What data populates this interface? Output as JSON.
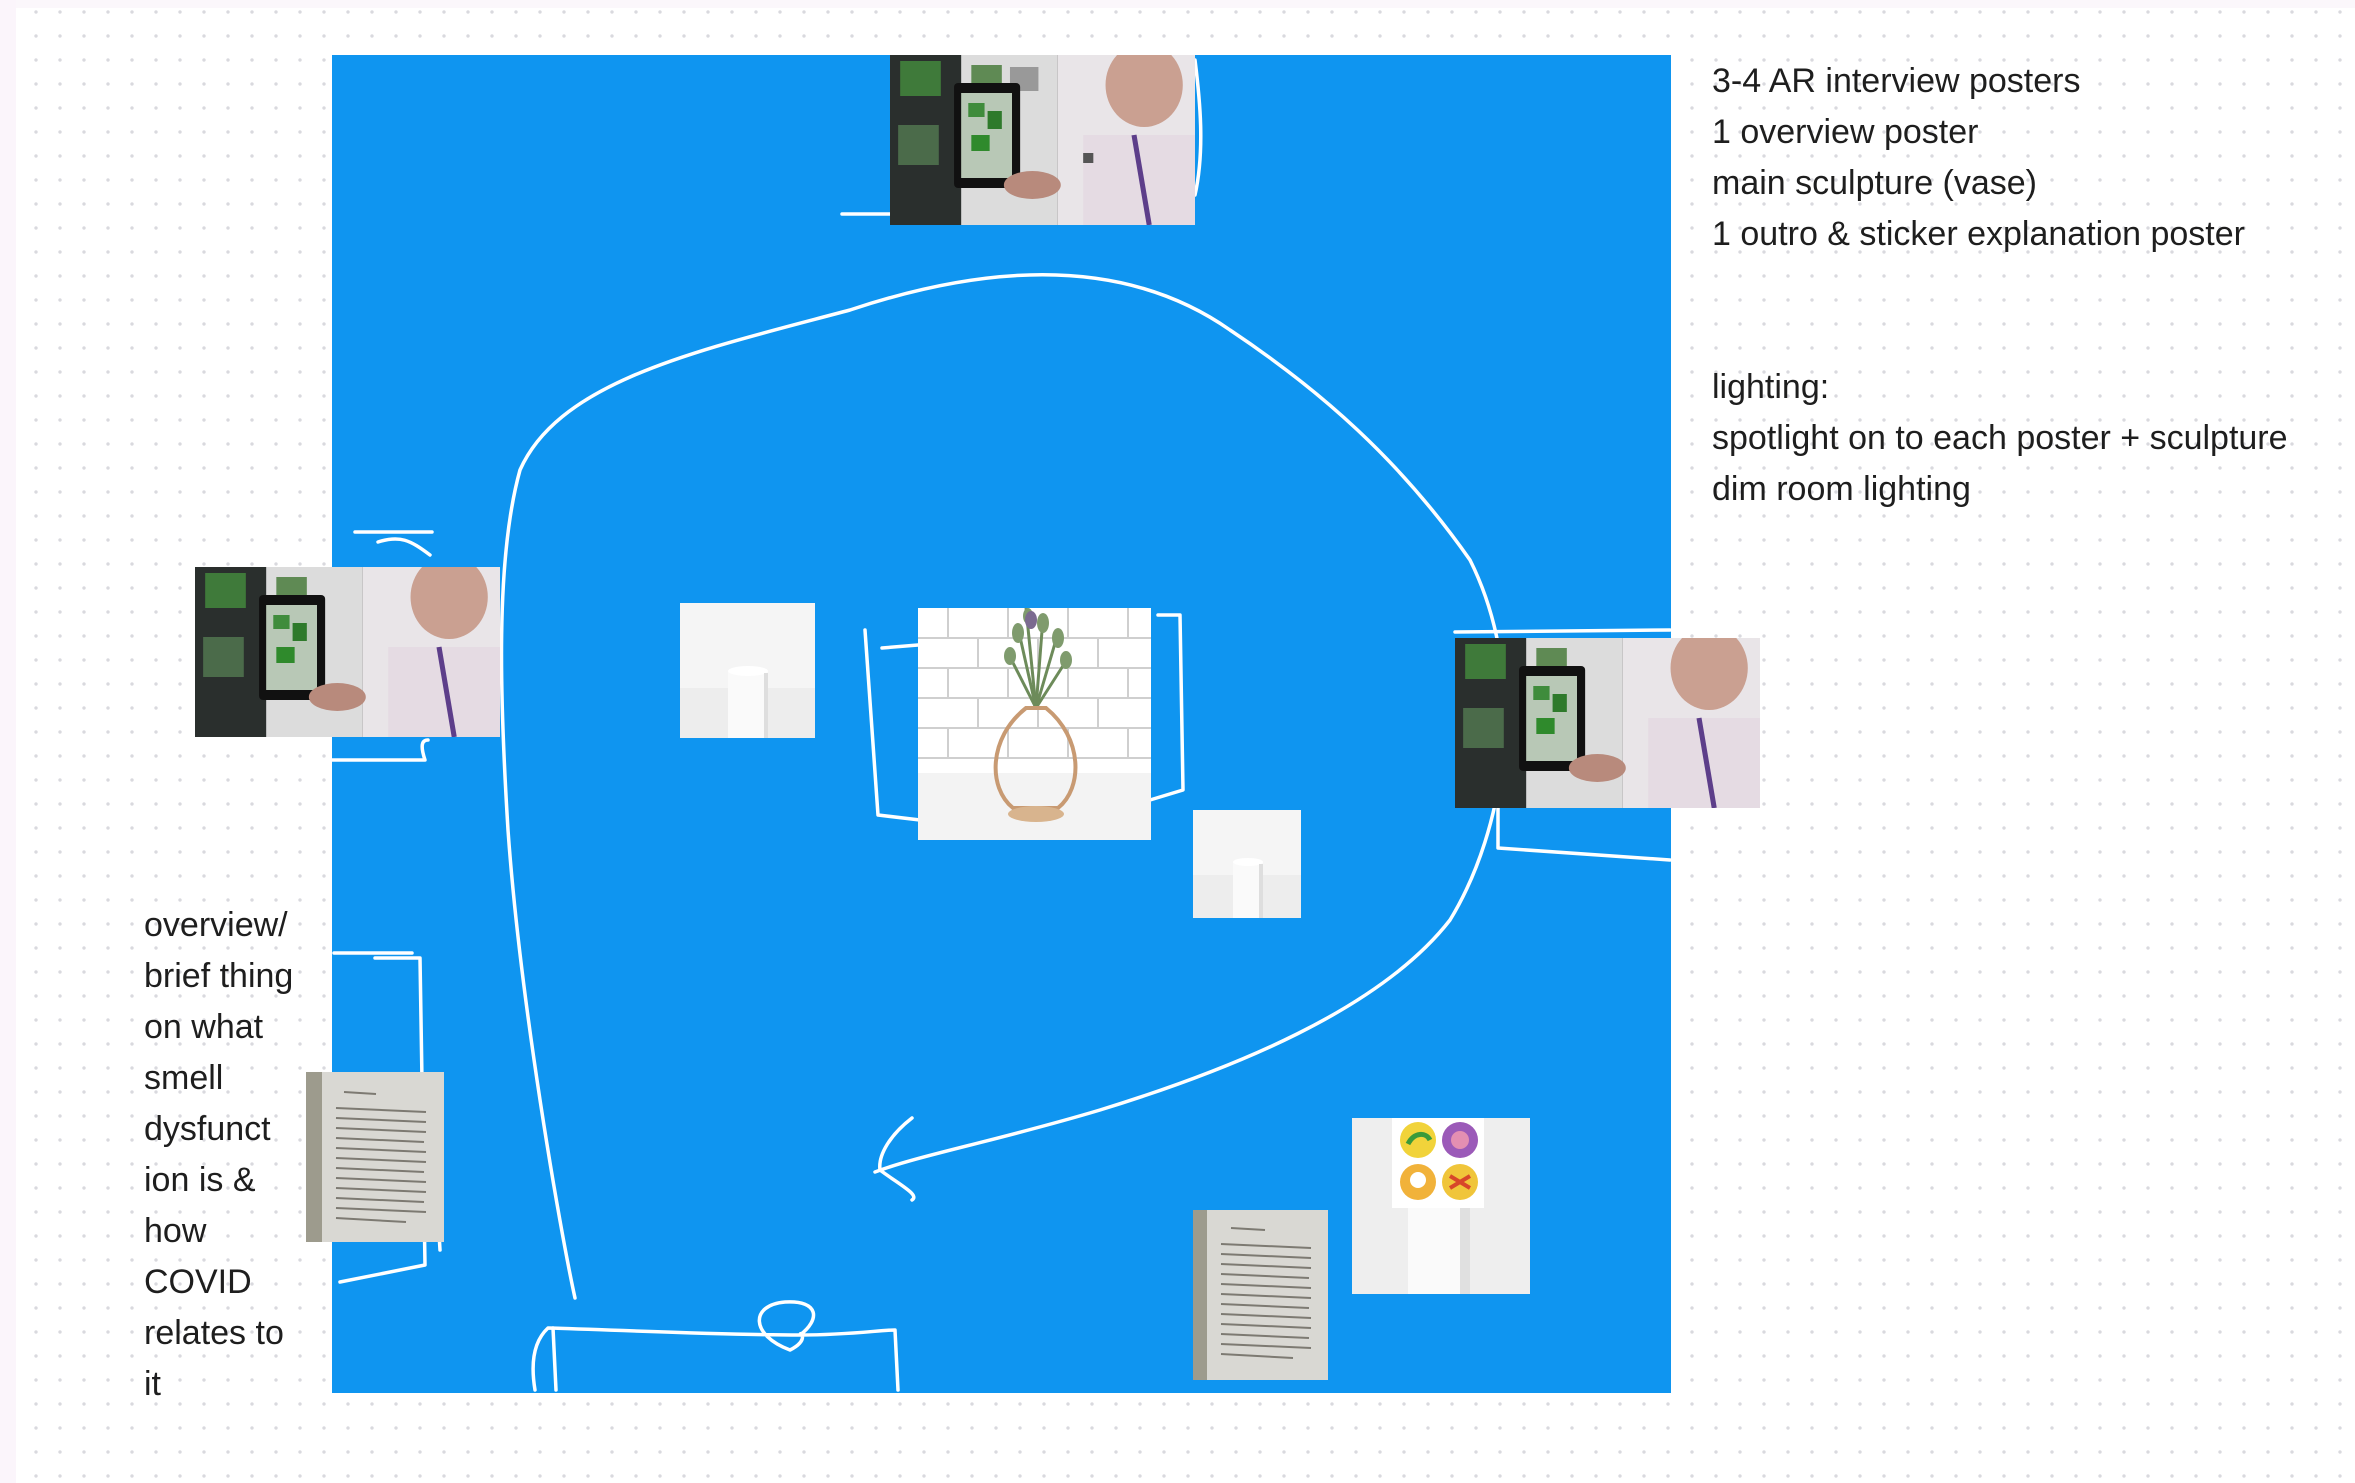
{
  "canvas": {
    "background": "#ffffff",
    "floor_color": "#0f95f0",
    "ink_color": "#ffffff",
    "text_color": "#1e1e1e"
  },
  "notes": {
    "plan_lines": [
      "3-4 AR interview posters",
      "1 overview poster",
      "main sculpture (vase)",
      "1 outro & sticker explanation poster"
    ],
    "lighting_lines": [
      "lighting:",
      "spotlight on to each poster + sculpture",
      "dim room lighting"
    ]
  },
  "side_note": {
    "lines": [
      "overview/",
      "brief thing",
      "on what",
      "smell",
      "dysfunct",
      "ion is &",
      "how",
      "COVID",
      "relates to",
      "it"
    ]
  },
  "icons": {
    "ar_photo": "ar-interview-photo-icon",
    "vase": "vase-sculpture-icon",
    "pedestal": "pedestal-icon",
    "poster": "text-poster-icon",
    "stickers": "sticker-sheet-icon",
    "path": "visitor-path-arrow-icon"
  }
}
